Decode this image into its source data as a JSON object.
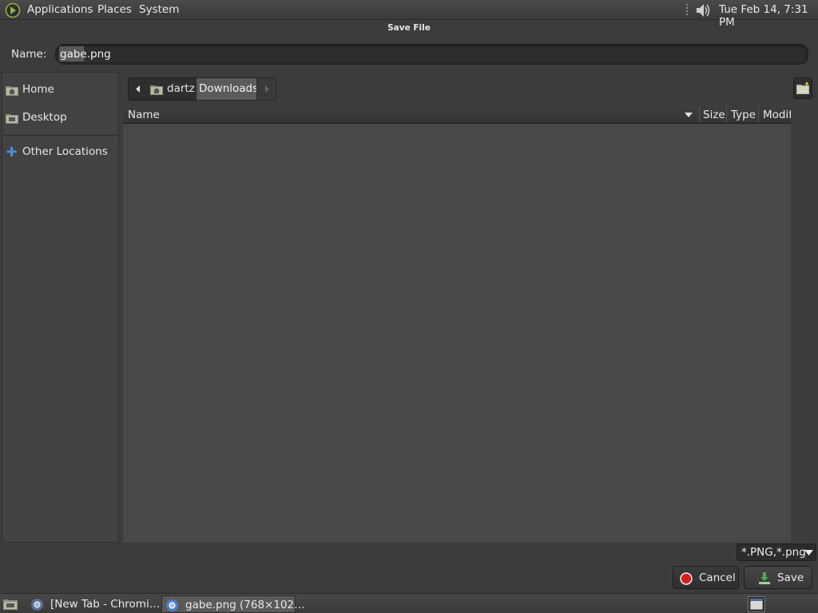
{
  "top_panel": {
    "menus": [
      "Applications",
      "Places",
      "System"
    ],
    "clock": "Tue Feb 14,  7:31 PM"
  },
  "dialog": {
    "title": "Save File",
    "name_label": "Name:",
    "name_value": "gabe.png"
  },
  "sidebar": {
    "items": [
      {
        "label": "Home",
        "icon": "home-folder-icon"
      },
      {
        "label": "Desktop",
        "icon": "desktop-folder-icon"
      },
      {
        "label": "Other Locations",
        "icon": "plus-icon"
      }
    ]
  },
  "path_bar": {
    "segments": [
      "dartz",
      "Downloads"
    ]
  },
  "file_list": {
    "columns": [
      "Name",
      "Size",
      "Type",
      "Modif"
    ],
    "rows": []
  },
  "footer": {
    "filter": "*.PNG,*.png",
    "cancel_label": "Cancel",
    "save_label": "Save"
  },
  "taskbar": {
    "tasks": [
      {
        "label": "[New Tab - Chromi…",
        "icon": "chromium-icon"
      },
      {
        "label": "gabe.png (768×102…",
        "icon": "chromium-icon"
      }
    ]
  },
  "colors": {
    "accent_blue": "#4a90d9",
    "cancel_red": "#d61f1f",
    "save_green": "#4caf50"
  }
}
